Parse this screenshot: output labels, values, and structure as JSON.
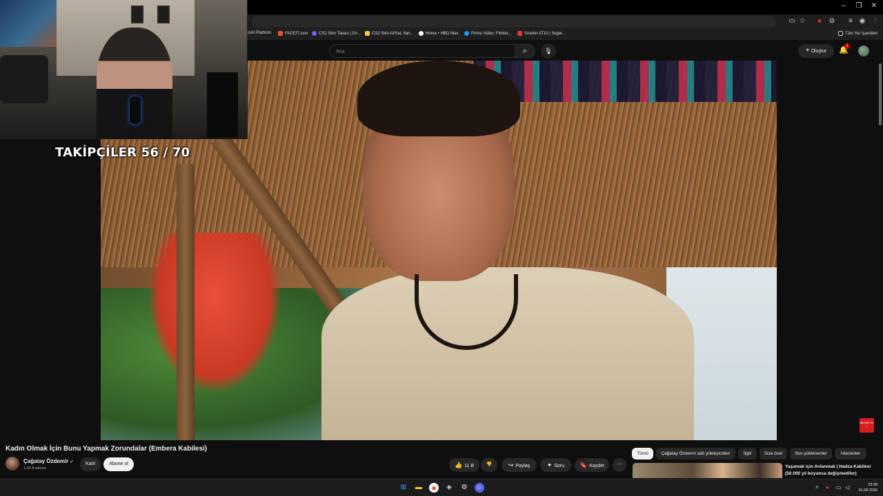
{
  "browser": {
    "bookmarks": [
      "enAI Platform",
      "FACEIT.com",
      "CS2 Skin Takası | En...",
      "CS2 Skin Al/Sat, İlan...",
      "Home • HBO Max",
      "Prime Video: Filmler...",
      "Snarler AT10 | Segw..."
    ],
    "all_bookmarks": "Tüm Yer İşaretleri"
  },
  "header": {
    "search_placeholder": "Ara",
    "create_label": "Oluştur",
    "notification_count": "1"
  },
  "overlay": {
    "followers": "TAKİPÇİLER 56 / 70",
    "sub_badge": "ABONE OL !"
  },
  "video": {
    "title": "Kadın Olmak İçin Bunu Yapmak Zorundalar (Embera Kabilesi)",
    "channel": "Çağatay Özdemir",
    "subscribers": "1,53 B abone",
    "join_label": "Katıl",
    "subscribe_label": "Abone ol",
    "likes": "11 B",
    "share_label": "Paylaş",
    "ask_label": "Soru",
    "save_label": "Kaydet"
  },
  "chips": [
    "Tümü",
    "Çağatay Özdemir adlı yükleyiciden",
    "İlgili",
    "Size özel",
    "Son yüklenenler",
    "İzlenenler"
  ],
  "related": {
    "title": "Yaşamak için Avlanmak | Hadza Kabilesi (50.000 yıl boyunca değişmediler)"
  },
  "taskbar": {
    "time": "23:38",
    "date": "31.08.2026"
  }
}
